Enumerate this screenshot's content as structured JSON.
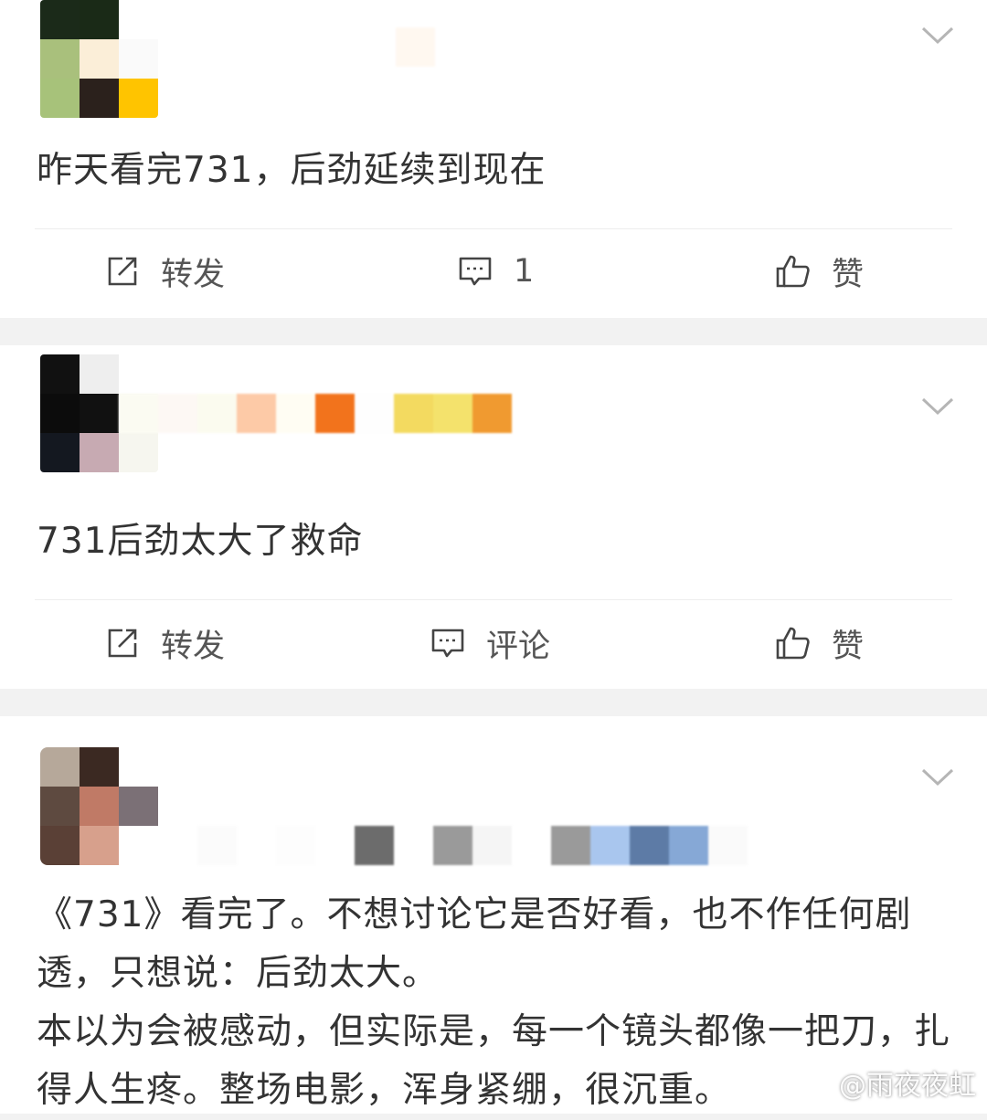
{
  "posts": [
    {
      "text": "昨天看完731，后劲延续到现在",
      "actions": {
        "repost": "转发",
        "comment": "1",
        "like": "赞"
      },
      "avatar_colors": [
        "#1b2a19",
        "#1a2a17",
        "#ffffff",
        "#a9c07c",
        "#fbeed8",
        "#fafafa",
        "#a7c27a",
        "#2b211c",
        "#ffc400"
      ],
      "name_colors": [
        "#ffffff",
        "#fff8f0",
        "#ffffff"
      ]
    },
    {
      "text": "731后劲太大了救命",
      "actions": {
        "repost": "转发",
        "comment": "评论",
        "like": "赞"
      },
      "avatar_colors": [
        "#111111",
        "#eeeeee",
        "#ffffff",
        "#0c0c0c",
        "#111111",
        "#fbfbf4",
        "#141820",
        "#c7aab2",
        "#f6f6ef"
      ],
      "name_colors": [
        "#fbfbf2",
        "#fdf8f4",
        "#fbfbef",
        "#fdcaa7",
        "#fffdf3",
        "#f2731c",
        "#fefefe",
        "#f3da60",
        "#f4e26c",
        "#f09a30"
      ]
    },
    {
      "text": "《731》看完了。不想讨论它是否好看，也不作任何剧透，只想说：后劲太大。\n本以为会被感动，但实际是，每一个镜头都像一把刀，扎得人生疼。整场电影，浑身紧绷，很沉重。",
      "avatar_colors": [
        "#b6a89a",
        "#3b2922",
        "#ffffff",
        "#5e4a40",
        "#c07a66",
        "#7b7076",
        "#5a4036",
        "#d7a08c",
        "#ffffff"
      ],
      "name_colors": [
        "#fbfbfb",
        "#ffffff",
        "#fdfdfd",
        "#ffffff",
        "#6c6c6c",
        "#ffffff",
        "#9a9a9a",
        "#f5f5f5",
        "#ffffff",
        "#9a9a9a",
        "#a9c6ee",
        "#5d7ba6",
        "#86a8d6",
        "#fafafa"
      ]
    }
  ],
  "icons": {
    "repost": "repost-icon",
    "comment": "comment-icon",
    "like": "thumbs-up-icon",
    "more": "chevron-down-icon"
  },
  "watermark": "@雨夜夜虹"
}
